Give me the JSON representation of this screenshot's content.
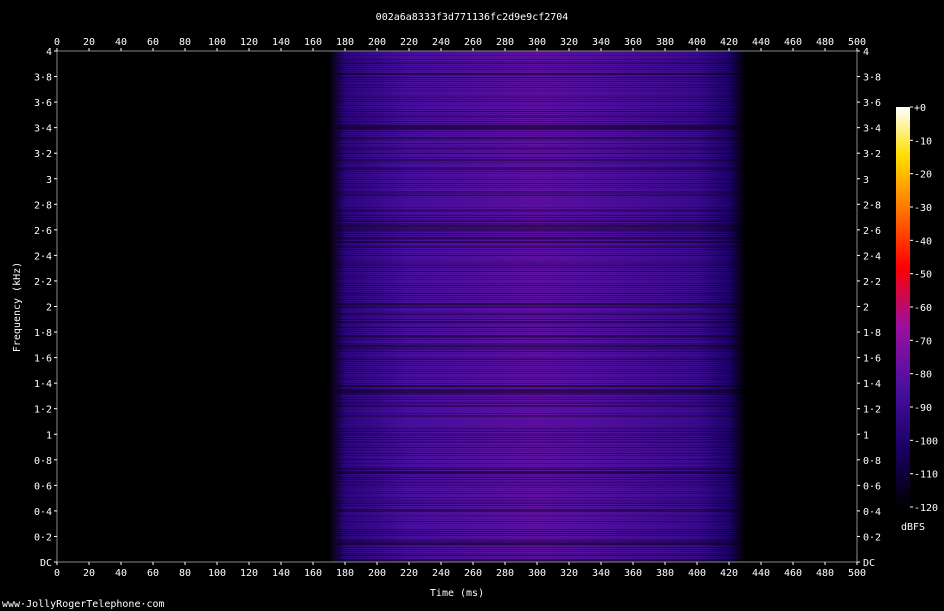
{
  "chart_data": {
    "type": "heatmap",
    "title": "002a6a8333f3d771136fc2d9e9cf2704",
    "xlabel": "Time (ms)",
    "ylabel": "Frequency (kHz)",
    "x_ticks": [
      "0",
      "20",
      "40",
      "60",
      "80",
      "100",
      "120",
      "140",
      "160",
      "180",
      "200",
      "220",
      "240",
      "260",
      "280",
      "300",
      "320",
      "340",
      "360",
      "380",
      "400",
      "420",
      "440",
      "460",
      "480",
      "500"
    ],
    "y_ticks": [
      "DC",
      "0·2",
      "0·4",
      "0·6",
      "0·8",
      "1",
      "1·2",
      "1·4",
      "1·6",
      "1·8",
      "2",
      "2·2",
      "2·4",
      "2·6",
      "2·8",
      "3",
      "3·2",
      "3·4",
      "3·6",
      "3·8",
      "4"
    ],
    "xlim": [
      0,
      500
    ],
    "ylim": [
      0,
      4
    ],
    "colorbar": {
      "label": "dBFS",
      "ticks": [
        "+0",
        "-10",
        "-20",
        "-30",
        "-40",
        "-50",
        "-60",
        "-70",
        "-80",
        "-90",
        "-100",
        "-110",
        "-120"
      ],
      "range": [
        -120,
        0
      ]
    },
    "energy_profile": {
      "time_ms": [
        0,
        170,
        180,
        220,
        300,
        330,
        400,
        420,
        430,
        500
      ],
      "level_dbfs": [
        -120,
        -120,
        -95,
        -85,
        -80,
        -82,
        -90,
        -100,
        -120,
        -120
      ]
    },
    "grid": false
  },
  "footer": "www·JollyRogerTelephone·com"
}
